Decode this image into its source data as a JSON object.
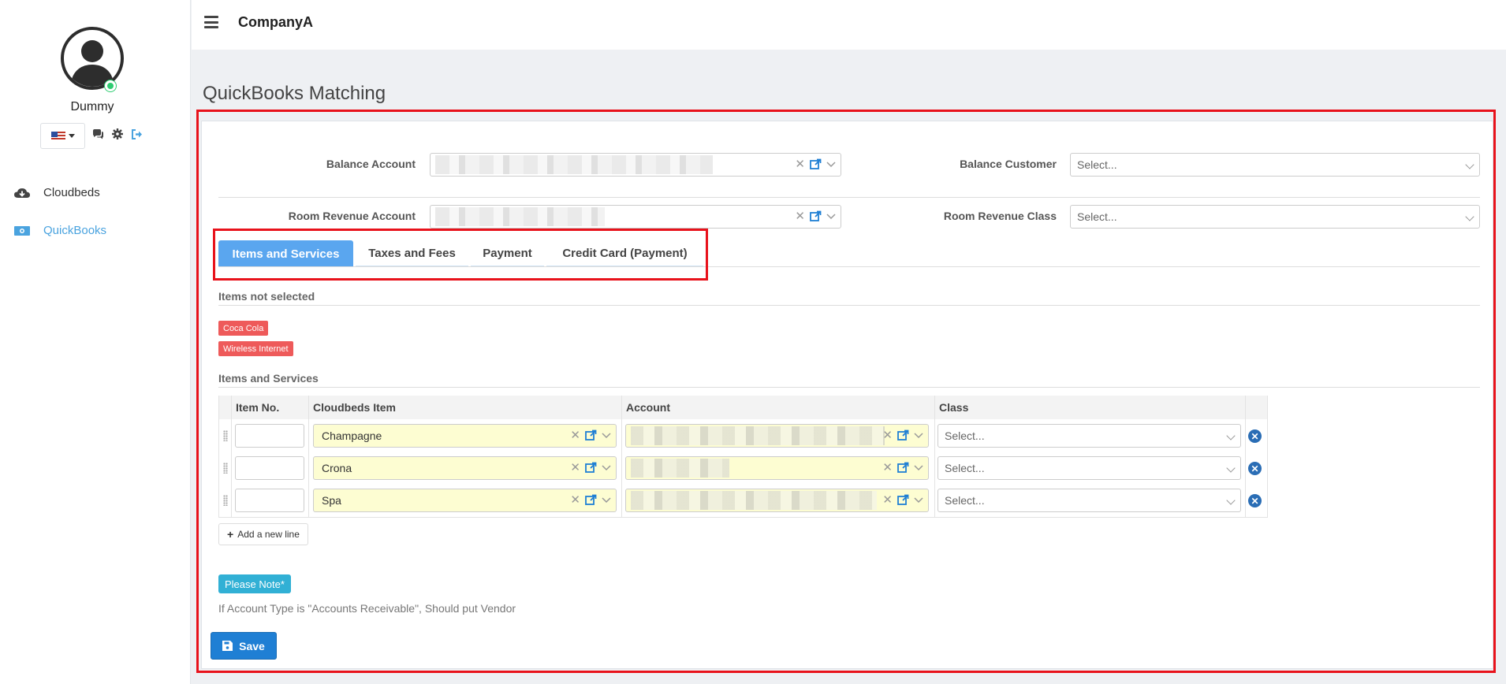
{
  "user": {
    "name": "Dummy"
  },
  "nav": {
    "items": [
      {
        "label": "Cloudbeds"
      },
      {
        "label": "QuickBooks"
      }
    ]
  },
  "header": {
    "brand": "CompanyA"
  },
  "page": {
    "title": "QuickBooks Matching"
  },
  "form": {
    "balance_account_label": "Balance Account",
    "balance_customer_label": "Balance Customer",
    "balance_customer_placeholder": "Select...",
    "room_revenue_account_label": "Room Revenue Account",
    "room_revenue_class_label": "Room Revenue Class",
    "room_revenue_class_placeholder": "Select..."
  },
  "tabs": [
    {
      "label": "Items and Services",
      "active": true
    },
    {
      "label": "Taxes and Fees",
      "active": false
    },
    {
      "label": "Payment",
      "active": false
    },
    {
      "label": "Credit Card (Payment)",
      "active": false
    }
  ],
  "not_selected": {
    "title": "Items not selected",
    "items": [
      "Coca Cola",
      "Wireless Internet"
    ]
  },
  "items_section": {
    "title": "Items and Services",
    "columns": [
      "Item No.",
      "Cloudbeds Item",
      "Account",
      "Class"
    ],
    "rows": [
      {
        "item_no": "",
        "cloudbeds_item": "Champagne",
        "class_placeholder": "Select..."
      },
      {
        "item_no": "",
        "cloudbeds_item": "Crona",
        "class_placeholder": "Select..."
      },
      {
        "item_no": "",
        "cloudbeds_item": "Spa",
        "class_placeholder": "Select..."
      }
    ],
    "add_line_label": "Add a new line"
  },
  "note": {
    "badge": "Please Note*",
    "text": "If Account Type is \"Accounts Receivable\", Should put Vendor"
  },
  "actions": {
    "save_label": "Save"
  },
  "colors": {
    "accent": "#5aa6ef",
    "primary_button": "#1f7fd4",
    "tag_red": "#ee5a5a",
    "highlight_red": "#e8121b",
    "info": "#31b0d5"
  }
}
